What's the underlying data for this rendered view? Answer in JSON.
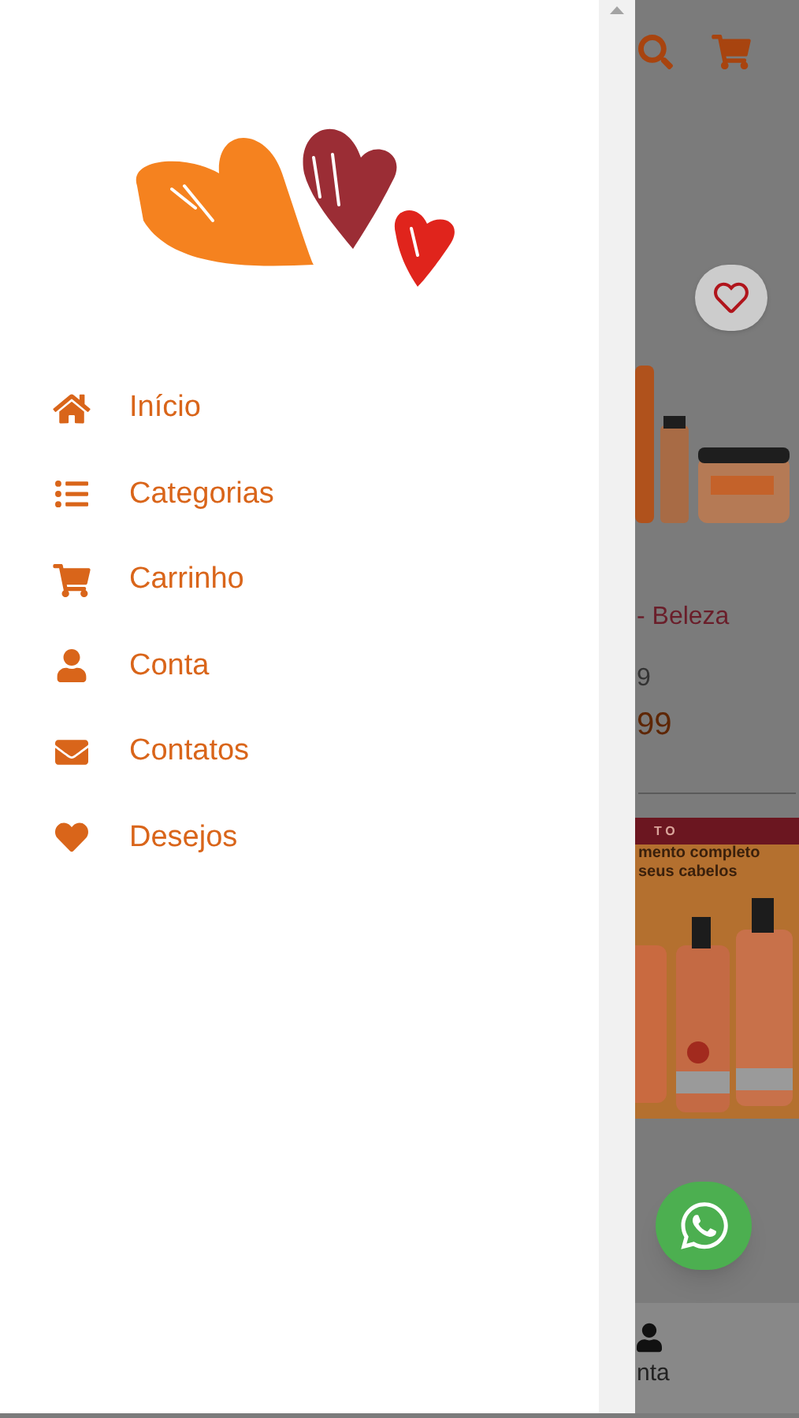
{
  "drawer": {
    "menu": [
      {
        "label": "Início",
        "kind": "home"
      },
      {
        "label": "Categorias",
        "kind": "list"
      },
      {
        "label": "Carrinho",
        "kind": "cart"
      },
      {
        "label": "Conta",
        "kind": "user"
      },
      {
        "label": "Contatos",
        "kind": "mail"
      },
      {
        "label": "Desejos",
        "kind": "heart"
      }
    ]
  },
  "page": {
    "product": {
      "title": "- Beleza",
      "old_price": "9",
      "price": "99"
    },
    "banner": {
      "tag": "T O",
      "lines": [
        "mento completo",
        "seus cabelos"
      ]
    },
    "bottom_nav": {
      "label": "nta"
    }
  }
}
